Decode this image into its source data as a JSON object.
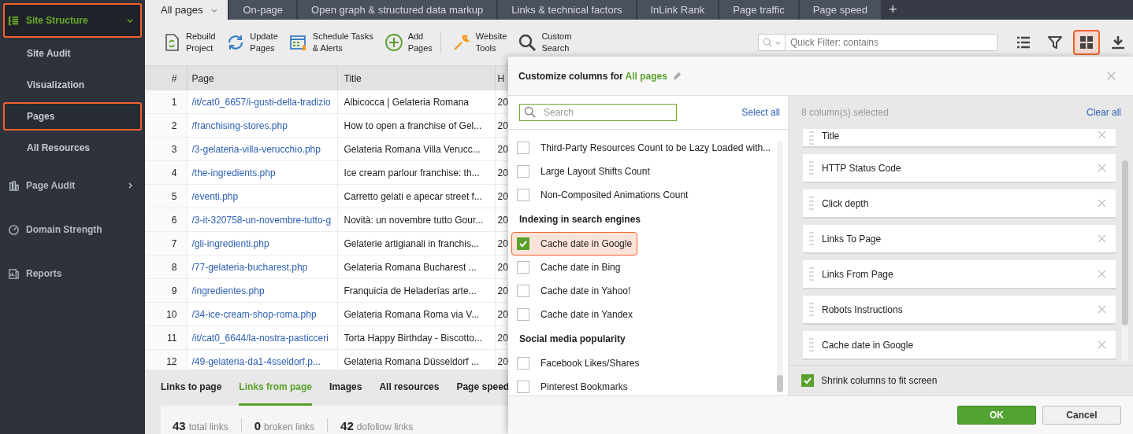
{
  "sidebar": {
    "items": [
      {
        "label": "Site Structure",
        "selected": true,
        "expanded": true,
        "children": [
          {
            "label": "Site Audit",
            "selected": false
          },
          {
            "label": "Visualization",
            "selected": false
          },
          {
            "label": "Pages",
            "selected": true
          },
          {
            "label": "All Resources",
            "selected": false
          }
        ]
      },
      {
        "label": "Page Audit",
        "selected": false,
        "expanded": false
      },
      {
        "label": "Domain Strength",
        "selected": false
      },
      {
        "label": "Reports",
        "selected": false
      }
    ]
  },
  "tabs": [
    {
      "label": "All pages",
      "selected": true
    },
    {
      "label": "On-page",
      "selected": false
    },
    {
      "label": "Open graph & structured data markup",
      "selected": false
    },
    {
      "label": "Links & technical factors",
      "selected": false
    },
    {
      "label": "InLink Rank",
      "selected": false
    },
    {
      "label": "Page traffic",
      "selected": false
    },
    {
      "label": "Page speed",
      "selected": false
    }
  ],
  "add_tab": "+",
  "toolbar": {
    "buttons": [
      {
        "lines": [
          "Rebuild",
          "Project"
        ]
      },
      {
        "lines": [
          "Update",
          "Pages"
        ]
      },
      {
        "lines": [
          "Schedule Tasks",
          "& Alerts"
        ]
      },
      {
        "lines": [
          "Add",
          "Pages"
        ]
      },
      {
        "lines": [
          "Website",
          "Tools"
        ]
      },
      {
        "lines": [
          "Custom",
          "Search"
        ]
      }
    ],
    "filter": {
      "placeholder": "Quick Filter: contains"
    },
    "view_buttons": [
      {
        "selected": false
      },
      {
        "selected": false
      },
      {
        "selected": true
      },
      {
        "selected": false
      }
    ]
  },
  "table": {
    "columns": [
      "#",
      "Page",
      "Title",
      "H"
    ],
    "rows": [
      [
        "1",
        "/it/cat0_6657/i-gusti-della-tradizio",
        "Albicocca | Gelateria Romana",
        "20"
      ],
      [
        "2",
        "/franchising-stores.php",
        "How to open a franchise of Gel...",
        "20"
      ],
      [
        "3",
        "/3-gelateria-villa-verucchio.php",
        "Gelateria Romana Villa Verucc...",
        "20"
      ],
      [
        "4",
        "/the-ingredients.php",
        "Ice cream parlour franchise: th...",
        "20"
      ],
      [
        "5",
        "/eventi.php",
        "Carretto gelati e apecar street f...",
        "20"
      ],
      [
        "6",
        "/3-it-320758-un-novembre-tutto-g",
        "Novità: un novembre tutto Gour...",
        "20"
      ],
      [
        "7",
        "/gli-ingredienti.php",
        "Gelaterie artigianali in franchis...",
        "20"
      ],
      [
        "8",
        "/77-gelateria-bucharest.php",
        "Gelateria Romana Bucharest ...",
        "20"
      ],
      [
        "9",
        "/ingredientes.php",
        "Franquicia de Heladerías arte...",
        "20"
      ],
      [
        "10",
        "/34-ice-cream-shop-roma.php",
        "Gelateria Romana Roma via V...",
        "20"
      ],
      [
        "11",
        "/it/cat0_6644/la-nostra-pasticceri",
        "Torta Happy Birthday - Biscotto...",
        "20"
      ],
      [
        "12",
        "/49-gelateria-da1-4sseldorf.p...",
        "Gelateria Romana Düsseldorf ...",
        "20"
      ]
    ]
  },
  "bottom_panel": {
    "tabs": [
      {
        "label": "Links to page",
        "selected": false
      },
      {
        "label": "Links from page",
        "selected": true
      },
      {
        "label": "Images",
        "selected": false
      },
      {
        "label": "All resources",
        "selected": false
      },
      {
        "label": "Page speed",
        "selected": false
      }
    ],
    "stats": [
      {
        "value": "43",
        "label": "total links"
      },
      {
        "value": "0",
        "label": "broken links"
      },
      {
        "value": "42",
        "label": "dofollow links"
      }
    ]
  },
  "dialog": {
    "title": "Customize columns for",
    "scope": "All pages",
    "search": {
      "placeholder": "Search"
    },
    "select_all": "Select all",
    "options": [
      {
        "kind": "option",
        "label": "Third-Party Resources Count to be Lazy Loaded with...",
        "checked": false,
        "selected": false
      },
      {
        "kind": "option",
        "label": "Large Layout Shifts Count",
        "checked": false,
        "selected": false
      },
      {
        "kind": "option",
        "label": "Non-Composited Animations Count",
        "checked": false,
        "selected": false
      },
      {
        "kind": "group",
        "label": "Indexing in search engines"
      },
      {
        "kind": "option",
        "label": "Cache date in Google",
        "checked": true,
        "selected": true
      },
      {
        "kind": "option",
        "label": "Cache date in Bing",
        "checked": false,
        "selected": false
      },
      {
        "kind": "option",
        "label": "Cache date in Yahoo!",
        "checked": false,
        "selected": false
      },
      {
        "kind": "option",
        "label": "Cache date in Yandex",
        "checked": false,
        "selected": false
      },
      {
        "kind": "group",
        "label": "Social media popularity"
      },
      {
        "kind": "option",
        "label": "Facebook Likes/Shares",
        "checked": false,
        "selected": false
      },
      {
        "kind": "option",
        "label": "Pinterest Bookmarks",
        "checked": false,
        "selected": false
      }
    ],
    "selected_count": "8 column(s) selected",
    "clear_all": "Clear all",
    "selected_columns": [
      "Title",
      "HTTP Status Code",
      "Click depth",
      "Links To Page",
      "Links From Page",
      "Robots Instructions",
      "Cache date in Google"
    ],
    "shrink": {
      "label": "Shrink columns to fit screen",
      "checked": true
    },
    "buttons": [
      {
        "label": "OK",
        "kind": "primary"
      },
      {
        "label": "Cancel",
        "kind": "secondary"
      }
    ]
  }
}
